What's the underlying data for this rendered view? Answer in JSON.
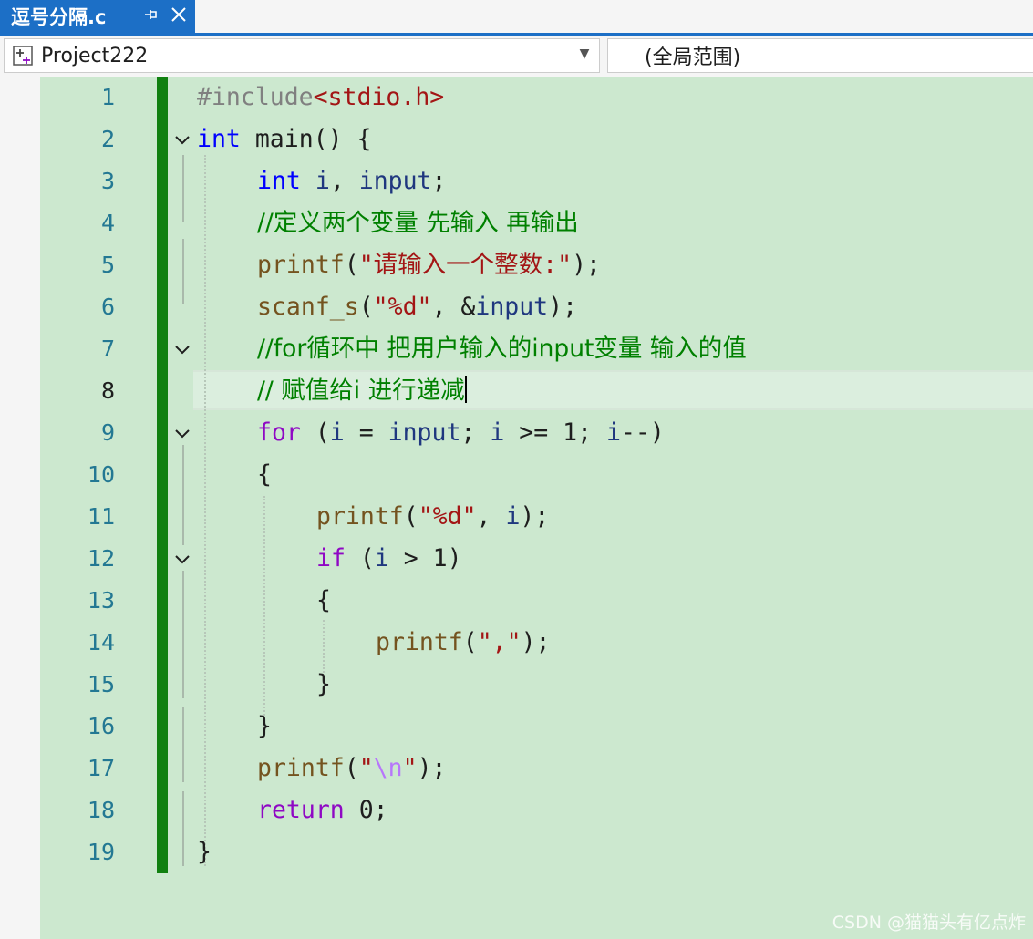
{
  "tab": {
    "title": "逗号分隔.c",
    "pin_icon": "pin-icon",
    "close_icon": "close-icon"
  },
  "nav": {
    "project": "Project222",
    "scope": "(全局范围)"
  },
  "editor": {
    "active_line": 8,
    "lines": [
      {
        "n": "1"
      },
      {
        "n": "2"
      },
      {
        "n": "3"
      },
      {
        "n": "4"
      },
      {
        "n": "5"
      },
      {
        "n": "6"
      },
      {
        "n": "7"
      },
      {
        "n": "8"
      },
      {
        "n": "9"
      },
      {
        "n": "10"
      },
      {
        "n": "11"
      },
      {
        "n": "12"
      },
      {
        "n": "13"
      },
      {
        "n": "14"
      },
      {
        "n": "15"
      },
      {
        "n": "16"
      },
      {
        "n": "17"
      },
      {
        "n": "18"
      },
      {
        "n": "19"
      }
    ],
    "tokens": {
      "l1": [
        "#include",
        "<stdio.h>"
      ],
      "l2": [
        "int",
        " main() {"
      ],
      "l3": [
        "int",
        " ",
        "i",
        ", ",
        "input",
        ";"
      ],
      "l4": [
        "//定义两个变量 先输入 再输出"
      ],
      "l5": [
        "printf",
        "(",
        "\"请输入一个整数:\"",
        ");"
      ],
      "l6": [
        "scanf_s",
        "(",
        "\"%d\"",
        ", &",
        "input",
        ");"
      ],
      "l7": [
        "//for循环中 把用户输入的input变量 输入的值"
      ],
      "l8": [
        "// 赋值给i 进行递减"
      ],
      "l9": [
        "for",
        " (",
        "i",
        " = ",
        "input",
        "; ",
        "i",
        " >= 1; ",
        "i",
        "--)"
      ],
      "l10": [
        "{"
      ],
      "l11": [
        "printf",
        "(",
        "\"%d\"",
        ", ",
        "i",
        ");"
      ],
      "l12": [
        "if",
        " (",
        "i",
        " > 1)"
      ],
      "l13": [
        "{"
      ],
      "l14": [
        "printf",
        "(",
        "\",\"",
        ");"
      ],
      "l15": [
        "}"
      ],
      "l16": [
        "}"
      ],
      "l17": [
        "printf",
        "(",
        "\"",
        "\\n",
        "\"",
        ");"
      ],
      "l18": [
        "return",
        " 0;"
      ],
      "l19": [
        "}"
      ]
    }
  },
  "watermark": "CSDN @猫猫头有亿点炸",
  "colors": {
    "accent": "#1c6fc6",
    "editor_bg": "#cce8cf",
    "change_bar": "#108010"
  }
}
